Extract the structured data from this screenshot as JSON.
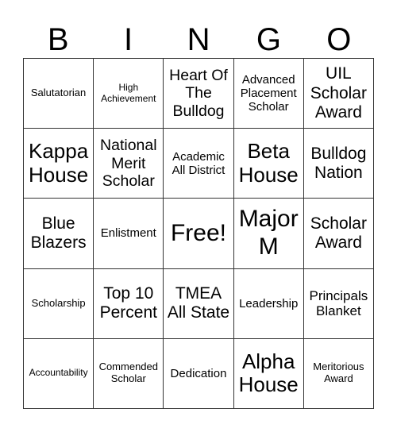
{
  "header": [
    "B",
    "I",
    "N",
    "G",
    "O"
  ],
  "cells": [
    [
      "Salutatorian",
      "High Achievement",
      "Heart Of The Bulldog",
      "Advanced Placement Scholar",
      "UIL Scholar Award"
    ],
    [
      "Kappa House",
      "National Merit Scholar",
      "Academic All District",
      "Beta House",
      "Bulldog Nation"
    ],
    [
      "Blue Blazers",
      "Enlistment",
      "Free!",
      "Major M",
      "Scholar Award"
    ],
    [
      "Scholarship",
      "Top 10 Percent",
      "TMEA All State",
      "Leadership",
      "Principals Blanket"
    ],
    [
      "Accountability",
      "Commended Scholar",
      "Dedication",
      "Alpha House",
      "Meritorious Award"
    ]
  ]
}
